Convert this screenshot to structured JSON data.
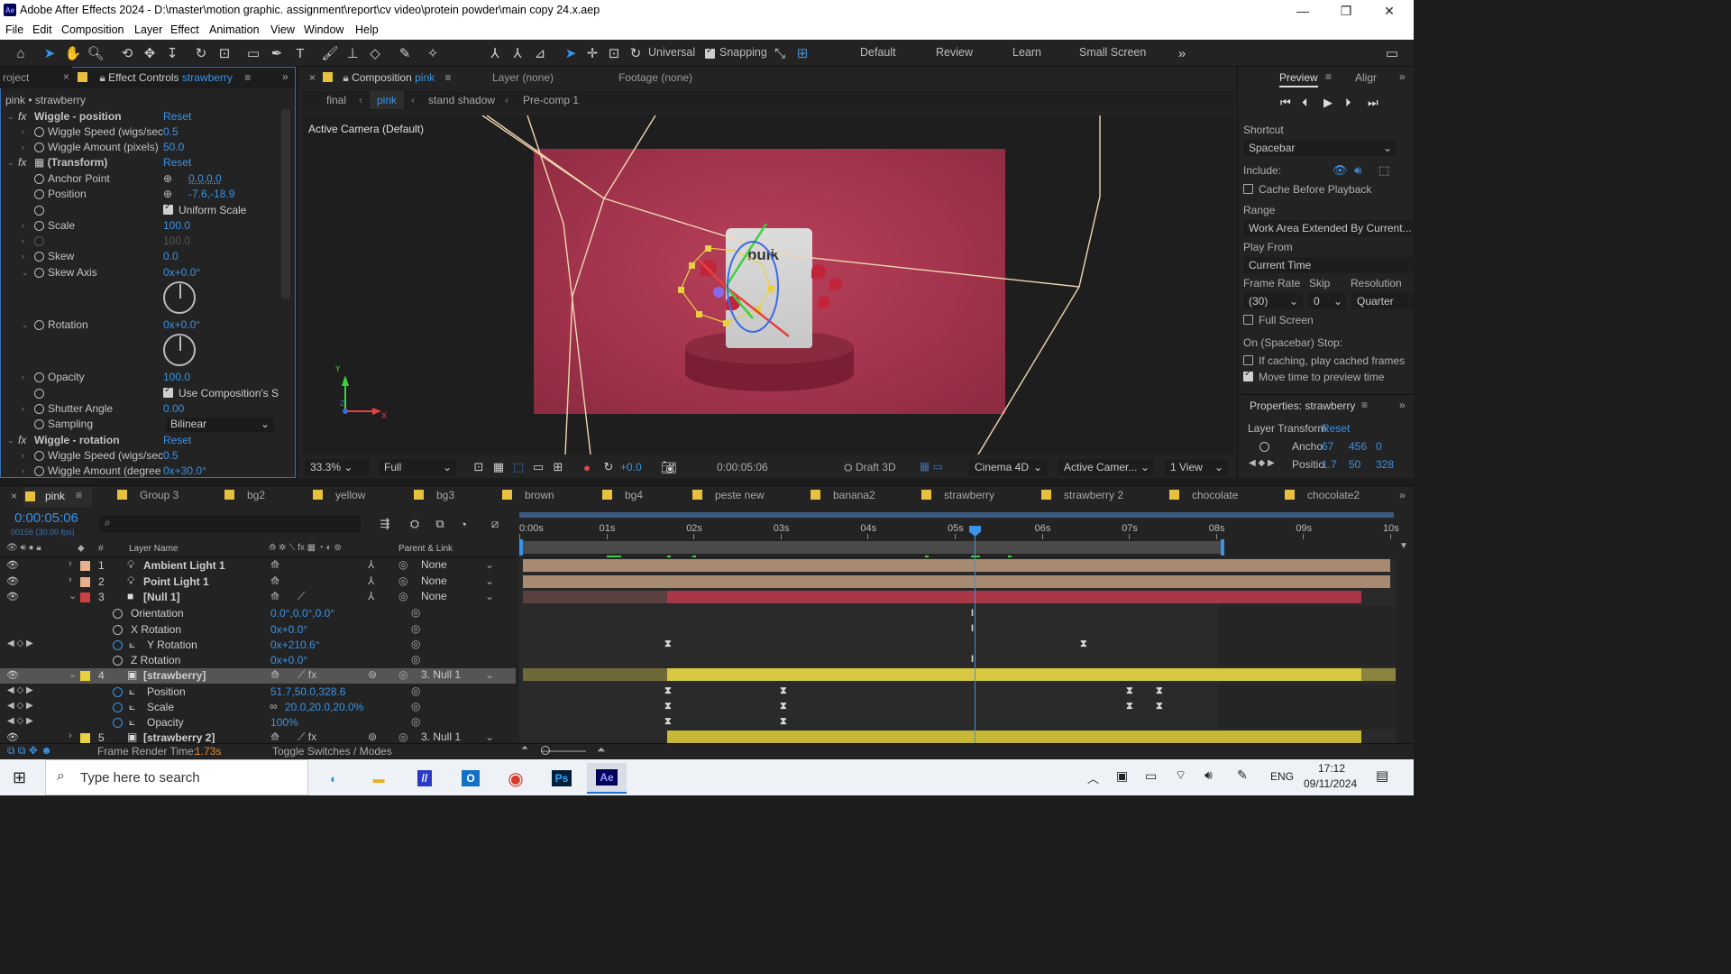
{
  "window": {
    "title": "Adobe After Effects 2024 - D:\\master\\motion graphic. assignment\\report\\cv video\\protein powder\\main copy 24.x.aep",
    "app_logo": "Ae"
  },
  "menu": [
    "File",
    "Edit",
    "Composition",
    "Layer",
    "Effect",
    "Animation",
    "View",
    "Window",
    "Help"
  ],
  "toolbar": {
    "axis_mode": "Universal",
    "snapping_label": "Snapping",
    "workspaces": [
      "Default",
      "Review",
      "Learn",
      "Small Screen"
    ]
  },
  "effect_controls": {
    "project_tab": "roject",
    "tab_label": "Effect Controls",
    "tab_layer": "strawberry",
    "breadcrumb": "pink • strawberry",
    "rows": {
      "wiggle_position": "Wiggle - position",
      "reset": "Reset",
      "wiggle_speed": "Wiggle Speed (wigs/sec",
      "wiggle_speed_val": "0.5",
      "wiggle_amount": "Wiggle Amount (pixels)",
      "wiggle_amount_val": "50.0",
      "transform": "(Transform)",
      "anchor_point": "Anchor Point",
      "anchor_point_val": "0.0,0.0",
      "position": "Position",
      "position_val": "-7.6,-18.9",
      "uniform_scale": "Uniform Scale",
      "scale": "Scale",
      "scale_val": "100.0",
      "scale_dim_val": "100.0",
      "skew": "Skew",
      "skew_val": "0.0",
      "skew_axis": "Skew Axis",
      "skew_axis_val": "0x+0.0°",
      "rotation": "Rotation",
      "rotation_val": "0x+0.0°",
      "opacity": "Opacity",
      "opacity_val": "100.0",
      "use_comp": "Use Composition's S",
      "shutter_angle": "Shutter Angle",
      "shutter_angle_val": "0.00",
      "sampling": "Sampling",
      "sampling_val": "Bilinear",
      "wiggle_rotation": "Wiggle - rotation",
      "wiggle_speed2": "Wiggle Speed (wigs/sec",
      "wiggle_speed2_val": "0.5",
      "wiggle_amount2": "Wiggle Amount (degree",
      "wiggle_amount2_val": "0x+30.0°"
    }
  },
  "composition": {
    "tab_label": "Composition",
    "tab_name": "pink",
    "layer_tab": "Layer (none)",
    "footage_tab": "Footage (none)",
    "breadcrumbs": [
      "final",
      "pink",
      "stand shadow",
      "Pre-comp 1"
    ],
    "camera_label": "Active Camera (Default)",
    "product_text": "bulk",
    "zoom": "33.3%",
    "resolution": "Full",
    "exposure": "+0.0",
    "timecode": "0:00:05:06",
    "renderer_mode": "Draft 3D",
    "renderer": "Cinema 4D",
    "camera": "Active Camer...",
    "views": "1 View"
  },
  "preview": {
    "tab": "Preview",
    "tab2": "Aligr",
    "shortcut_label": "Shortcut",
    "shortcut_val": "Spacebar",
    "include_label": "Include:",
    "cache_before": "Cache Before Playback",
    "range_label": "Range",
    "range_val": "Work Area Extended By Current...",
    "play_from_label": "Play From",
    "play_from_val": "Current Time",
    "frame_rate_label": "Frame Rate",
    "skip_label": "Skip",
    "resolution_label": "Resolution",
    "frame_rate_val": "(30)",
    "skip_val": "0",
    "resolution_val": "Quarter",
    "full_screen": "Full Screen",
    "on_stop": "On (Spacebar) Stop:",
    "if_caching": "If caching, play cached frames",
    "move_time": "Move time to preview time",
    "properties_tab": "Properties: strawberry",
    "layer_transform": "Layer Transform",
    "reset": "Reset",
    "anchor_label": "Ancho",
    "anchor_vals": [
      "67",
      "456",
      "0"
    ],
    "position_label": "Positio",
    "position_vals": [
      "1.7",
      "50",
      "328"
    ]
  },
  "timeline": {
    "tabs": [
      "pink",
      "Group 3",
      "bg2",
      "yellow",
      "bg3",
      "brown",
      "bg4",
      "peste new",
      "banana2",
      "strawberry",
      "strawberry 2",
      "chocolate",
      "chocolate2"
    ],
    "tab_colors": [
      "#e8c040",
      "#e8c040",
      "#e8c040",
      "#e8c040",
      "#e8c040",
      "#e8c040",
      "#e8c040",
      "#e8c040",
      "#e8c040",
      "#e8c040",
      "#e8c040",
      "#e8c040",
      "#e8c040"
    ],
    "timecode": "0:00:05:06",
    "frame_info": "00156 (30.00 fps)",
    "col_layer_name": "Layer Name",
    "col_parent": "Parent & Link",
    "col_num": "#",
    "ruler": [
      "0:00s",
      "01s",
      "02s",
      "03s",
      "04s",
      "05s",
      "06s",
      "07s",
      "08s",
      "09s",
      "10s"
    ],
    "layers": [
      {
        "num": "1",
        "name": "Ambient Light 1",
        "color": "#e8b08a",
        "parent": "None"
      },
      {
        "num": "2",
        "name": "Point Light 1",
        "color": "#e8b08a",
        "parent": "None"
      },
      {
        "num": "3",
        "name": "[Null 1]",
        "color": "#d04040",
        "parent": "None"
      },
      {
        "num": "4",
        "name": "[strawberry]",
        "color": "#e8d040",
        "parent": "3. Null 1"
      },
      {
        "num": "5",
        "name": "[strawberry 2]",
        "color": "#e8d040",
        "parent": "3. Null 1"
      }
    ],
    "props": {
      "orientation": "Orientation",
      "orientation_val": "0.0°,0.0°,0.0°",
      "x_rotation": "X Rotation",
      "x_rotation_val": "0x+0.0°",
      "y_rotation": "Y Rotation",
      "y_rotation_val": "0x+210.6°",
      "z_rotation": "Z Rotation",
      "z_rotation_val": "0x+0.0°",
      "position": "Position",
      "position_val": "51.7,50.0,328.6",
      "scale": "Scale",
      "scale_val": "20.0,20.0,20.0%",
      "opacity": "Opacity",
      "opacity_val": "100%"
    },
    "frame_render_label": "Frame Render Time:",
    "frame_render_val": "1.73s",
    "toggle_label": "Toggle Switches / Modes"
  },
  "taskbar": {
    "search_placeholder": "Type here to search",
    "apps": [
      "Edge",
      "Explorer",
      "Ai",
      "Outlook",
      "Chrome",
      "Ps",
      "Ae"
    ],
    "lang": "ENG",
    "time": "17:12",
    "date": "09/11/2024"
  }
}
